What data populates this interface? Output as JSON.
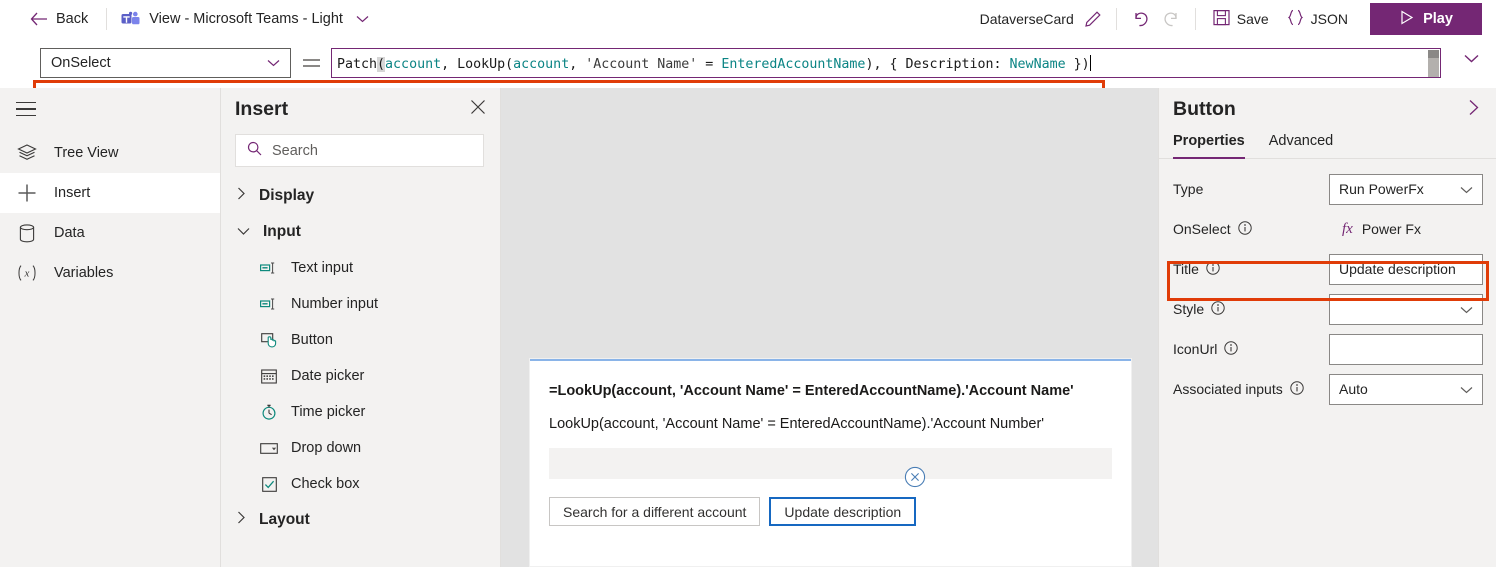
{
  "topbar": {
    "back_label": "Back",
    "view_title": "View - Microsoft Teams - Light",
    "card_name": "DataverseCard",
    "save_label": "Save",
    "json_label": "JSON",
    "play_label": "Play",
    "icons": {
      "back": "arrow-left-icon",
      "teams": "microsoft-teams-logo-icon",
      "title_chevron": "chevron-down-icon",
      "edit": "pencil-icon",
      "undo": "undo-arrow-icon",
      "redo": "redo-arrow-icon",
      "save": "floppy-disk-icon",
      "json": "curly-braces-icon",
      "play": "play-triangle-icon"
    }
  },
  "formula_bar": {
    "property": "OnSelect",
    "equals": "=",
    "formula_full": "Patch(account, LookUp(account, 'Account Name' = EnteredAccountName), { Description: NewName })",
    "tokens": [
      {
        "t": "Patch",
        "c": "fx-op"
      },
      {
        "t": "(",
        "c": "fx-paren-hl"
      },
      {
        "t": "account",
        "c": "fx-ident"
      },
      {
        "t": ", LookUp",
        "c": "fx-op"
      },
      {
        "t": "(",
        "c": "fx-op"
      },
      {
        "t": "account",
        "c": "fx-ident"
      },
      {
        "t": ", ",
        "c": "fx-op"
      },
      {
        "t": "'Account Name'",
        "c": "fx-str"
      },
      {
        "t": " = ",
        "c": "fx-op"
      },
      {
        "t": "EnteredAccountName",
        "c": "fx-ident"
      },
      {
        "t": "), { ",
        "c": "fx-op"
      },
      {
        "t": "Description",
        "c": "fx-op"
      },
      {
        "t": ": ",
        "c": "fx-op"
      },
      {
        "t": "NewName",
        "c": "fx-ident"
      },
      {
        "t": " })",
        "c": "fx-op"
      }
    ],
    "highlight_color": "#e03c08",
    "border_color": "#742774"
  },
  "rail": {
    "items": [
      {
        "label": "Tree View",
        "icon": "layers-icon",
        "active": false
      },
      {
        "label": "Insert",
        "icon": "plus-icon",
        "active": true
      },
      {
        "label": "Data",
        "icon": "database-icon",
        "active": false
      },
      {
        "label": "Variables",
        "icon": "variable-x-icon",
        "active": false
      }
    ],
    "menu_icon": "hamburger-menu-icon"
  },
  "insert_panel": {
    "title": "Insert",
    "close_icon": "close-icon",
    "search_placeholder": "Search",
    "search_value": "",
    "groups": [
      {
        "label": "Display",
        "expanded": false,
        "items": []
      },
      {
        "label": "Input",
        "expanded": true,
        "items": [
          {
            "label": "Text input",
            "icon": "text-input-icon"
          },
          {
            "label": "Number input",
            "icon": "number-input-icon"
          },
          {
            "label": "Button",
            "icon": "button-icon"
          },
          {
            "label": "Date picker",
            "icon": "calendar-icon"
          },
          {
            "label": "Time picker",
            "icon": "clock-icon"
          },
          {
            "label": "Drop down",
            "icon": "dropdown-icon"
          },
          {
            "label": "Check box",
            "icon": "checkbox-icon"
          }
        ]
      },
      {
        "label": "Layout",
        "expanded": false,
        "items": []
      }
    ]
  },
  "canvas": {
    "card": {
      "line1": "=LookUp(account, 'Account Name' = EnteredAccountName).'Account Name'",
      "line2": "LookUp(account, 'Account Name' = EnteredAccountName).'Account Number'",
      "text_input_value": "",
      "buttons": [
        {
          "label": "Search for a different account",
          "selected": false
        },
        {
          "label": "Update description",
          "selected": true
        }
      ],
      "delete_icon": "circle-x-delete-icon"
    }
  },
  "right_panel": {
    "title": "Button",
    "expand_icon": "chevron-right-icon",
    "tabs": [
      {
        "label": "Properties",
        "active": true
      },
      {
        "label": "Advanced",
        "active": false
      }
    ],
    "properties": [
      {
        "label": "Type",
        "control": "dropdown",
        "value": "Run PowerFx",
        "info": false
      },
      {
        "label": "OnSelect",
        "control": "powerfx",
        "value": "Power Fx",
        "info": true
      },
      {
        "label": "Title",
        "control": "text",
        "value": "Update description",
        "info": true,
        "highlighted": true
      },
      {
        "label": "Style",
        "control": "dropdown",
        "value": "",
        "info": true
      },
      {
        "label": "IconUrl",
        "control": "text",
        "value": "",
        "info": true
      },
      {
        "label": "Associated inputs",
        "control": "dropdown",
        "value": "Auto",
        "info": true
      }
    ],
    "fx_label": "fx"
  }
}
